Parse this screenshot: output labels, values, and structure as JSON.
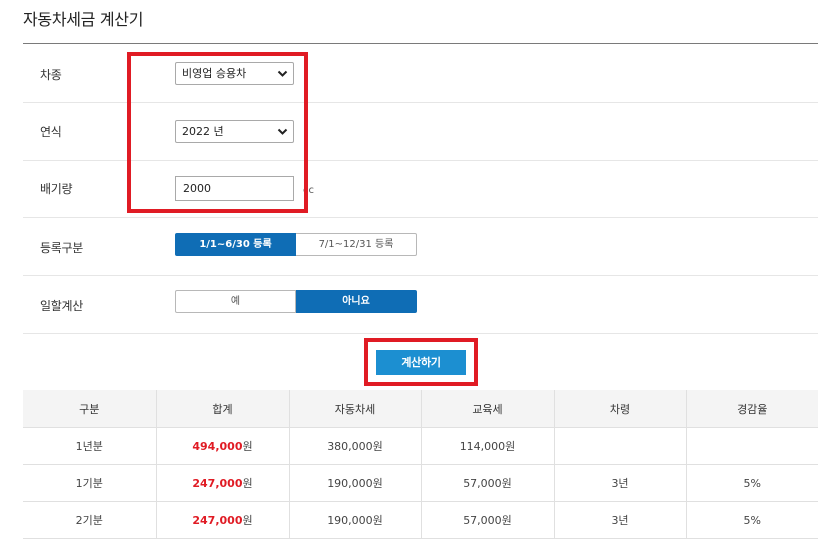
{
  "page": {
    "title": "자동차세금 계산기"
  },
  "form": {
    "car_type": {
      "label": "차종",
      "value": "비영업 승용차"
    },
    "year": {
      "label": "연식",
      "value": "2022 년"
    },
    "displacement": {
      "label": "배기량",
      "value": "2000",
      "unit": "cc"
    },
    "registration": {
      "label": "등록구분",
      "options": [
        "1/1~6/30 등록",
        "7/1~12/31 등록"
      ],
      "selected": "1/1~6/30 등록"
    },
    "prorate": {
      "label": "일할계산",
      "options": [
        "예",
        "아니요"
      ],
      "selected": "아니요"
    }
  },
  "calculate_label": "계산하기",
  "table": {
    "headers": [
      "구분",
      "합계",
      "자동차세",
      "교육세",
      "차령",
      "경감율"
    ],
    "rows": [
      {
        "period": "1년분",
        "total_num": "494,000",
        "total_unit": "원",
        "car_tax": "380,000원",
        "edu_tax": "114,000원",
        "age": "",
        "discount": ""
      },
      {
        "period": "1기분",
        "total_num": "247,000",
        "total_unit": "원",
        "car_tax": "190,000원",
        "edu_tax": "57,000원",
        "age": "3년",
        "discount": "5%"
      },
      {
        "period": "2기분",
        "total_num": "247,000",
        "total_unit": "원",
        "car_tax": "190,000원",
        "edu_tax": "57,000원",
        "age": "3년",
        "discount": "5%"
      }
    ]
  },
  "colors": {
    "accent": "#0f6db5",
    "button": "#1c8fd1",
    "highlight": "#e01b24"
  }
}
